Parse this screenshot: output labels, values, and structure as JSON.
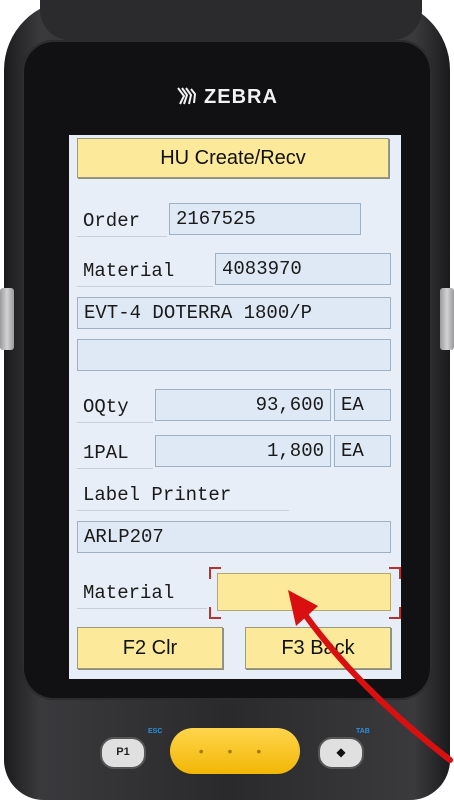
{
  "brand": {
    "name": "ZEBRA",
    "logo_icon": "zebra-head-icon"
  },
  "screen": {
    "title_button": "HU Create/Recv",
    "order": {
      "label": "Order",
      "value": "2167525"
    },
    "material": {
      "label": "Material",
      "value": "4083970"
    },
    "description": "EVT-4 DOTERRA 1800/P",
    "blank_field": "",
    "oqty": {
      "label": "OQty",
      "value": "93,600",
      "unit": "EA"
    },
    "pal": {
      "label": "1PAL",
      "value": "1,800",
      "unit": "EA"
    },
    "printer": {
      "label": "Label Printer",
      "value": "ARLP207"
    },
    "material_scan": {
      "label": "Material",
      "value": ""
    },
    "buttons": {
      "f2": "F2 Clr",
      "f3": "F3 Back"
    }
  },
  "keypad": {
    "p1": "P1",
    "scan_dots": "• • •",
    "diamond": "◆",
    "esc_label": "ESC",
    "tab_label": "TAB"
  },
  "colors": {
    "button_bg": "#fde99a",
    "field_bg": "#dfe9f5",
    "screen_bg": "#e7eef7",
    "arrow": "#d91010",
    "scan_key": "#f2b705"
  }
}
